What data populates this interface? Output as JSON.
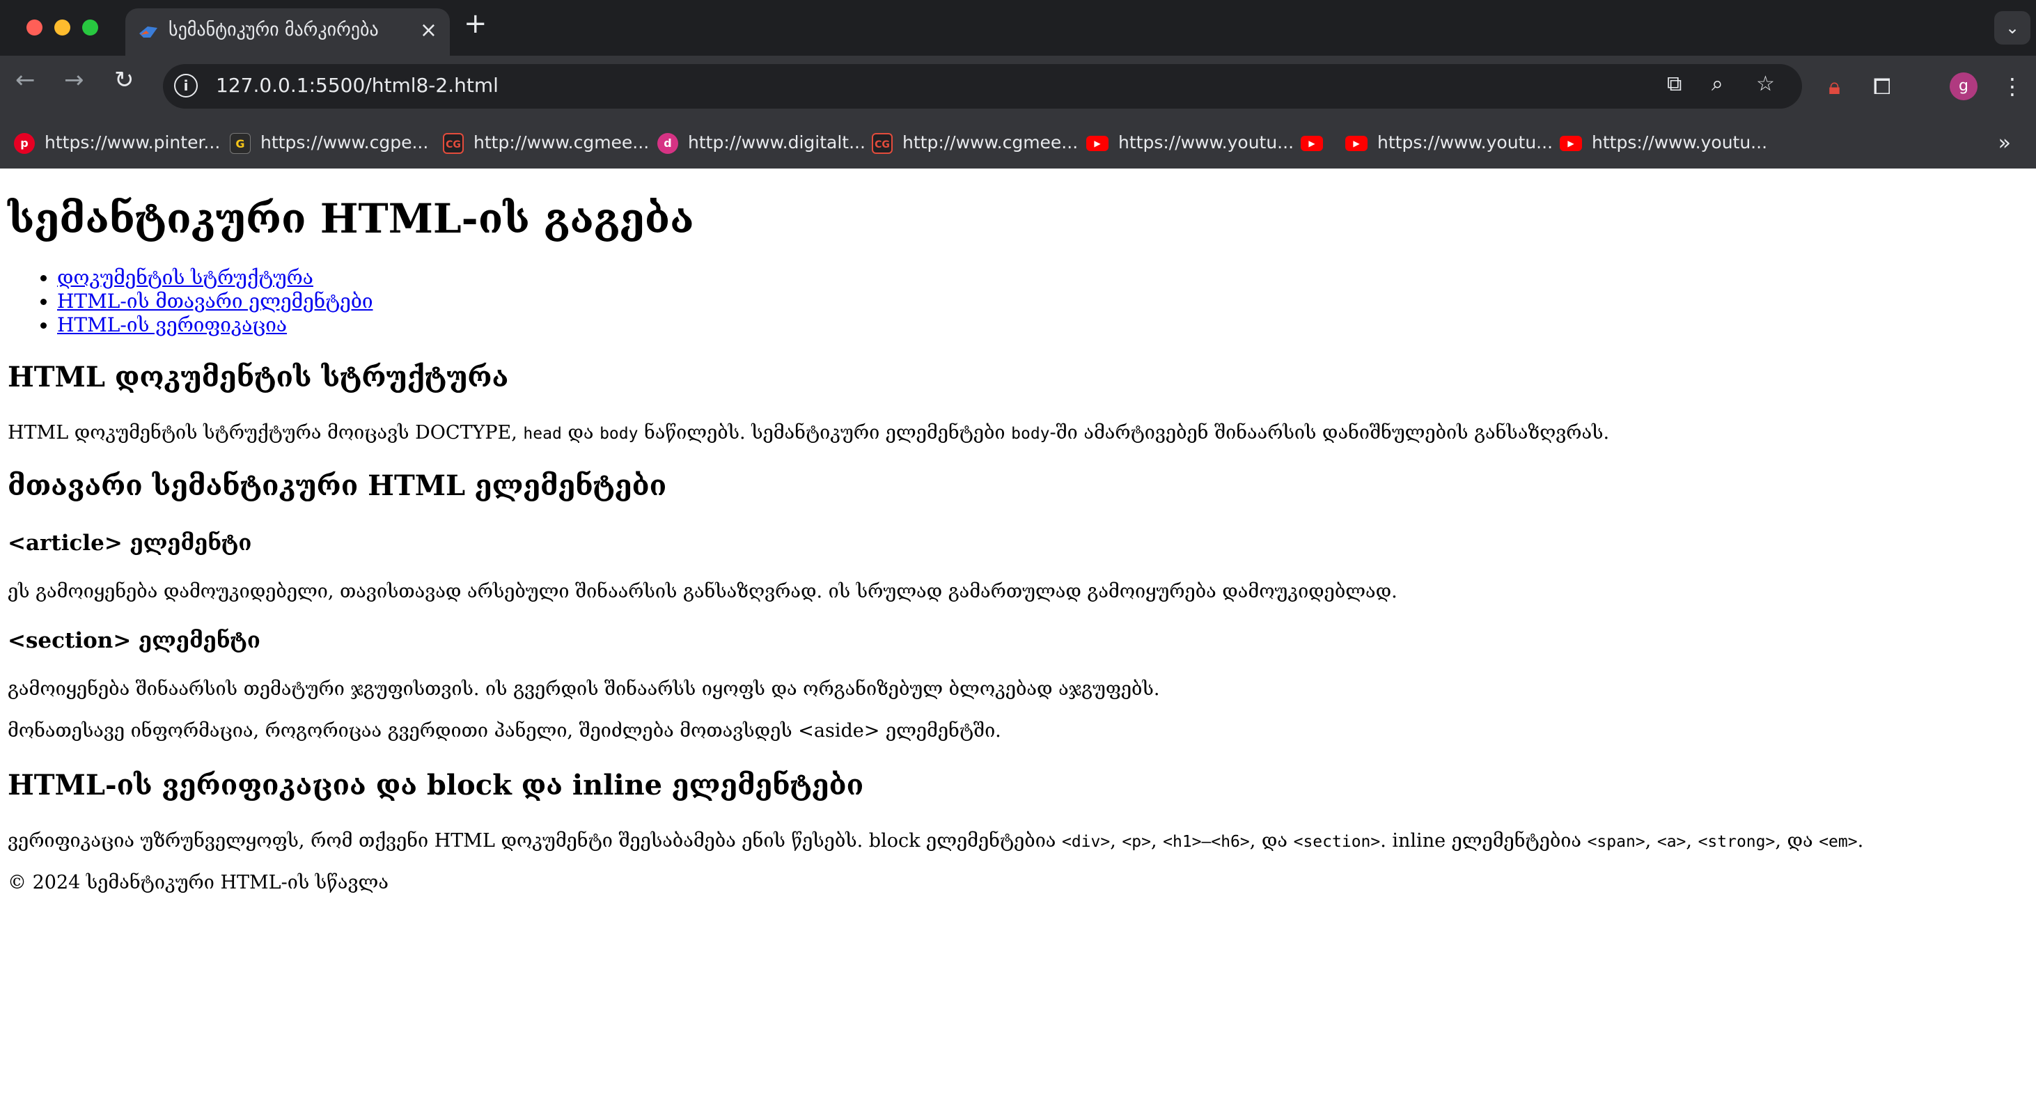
{
  "browser": {
    "tab_title": "სემანტიკური მარკირება",
    "tab_close": "×",
    "new_tab": "+",
    "url": "127.0.0.1:5500/html8-2.html",
    "profile_initial": "g",
    "bookmarks": [
      {
        "label": "https://www.pinter...",
        "icon": "pinterest-icon"
      },
      {
        "label": "https://www.cgpe...",
        "icon": "cgpeers-icon"
      },
      {
        "label": "http://www.cgmee...",
        "icon": "cgmeetup-icon"
      },
      {
        "label": "http://www.digitalt...",
        "icon": "digitaltutors-icon"
      },
      {
        "label": "http://www.cgmee...",
        "icon": "cgmeetup-icon"
      },
      {
        "label": "https://www.youtu...",
        "icon": "youtube-icon"
      },
      {
        "label": "",
        "icon": "youtube-icon"
      },
      {
        "label": "https://www.youtu...",
        "icon": "youtube-icon"
      },
      {
        "label": "https://www.youtu...",
        "icon": "youtube-icon"
      }
    ]
  },
  "page": {
    "title": "სემანტიკური HTML-ის გაგება",
    "toc": [
      "დოკუმენტის სტრუქტურა",
      "HTML-ის მთავარი ელემენტები",
      "HTML-ის ვერიფიკაცია"
    ],
    "s1_heading": "HTML დოკუმენტის სტრუქტურა",
    "s1_p": {
      "a": "HTML დოკუმენტის სტრუქტურა მოიცავს DOCTYPE, ",
      "code1": "head",
      "b": " და ",
      "code2": "body",
      "c": " ნაწილებს. სემანტიკური ელემენტები ",
      "code3": "body",
      "d": "-ში ამარტივებენ შინაარსის დანიშნულების განსაზღვრას."
    },
    "s2_heading": "მთავარი სემანტიკური HTML ელემენტები",
    "article_heading": "<article> ელემენტი",
    "article_p": "ეს გამოიყენება დამოუკიდებელი, თავისთავად არსებული შინაარსის განსაზღვრად. ის სრულად გამართულად გამოიყურება დამოუკიდებლად.",
    "section_heading": "<section> ელემენტი",
    "section_p1": "გამოიყენება შინაარსის თემატური ჯგუფისთვის. ის გვერდის შინაარსს იყოფს და ორგანიზებულ ბლოკებად აჯგუფებს.",
    "section_p2": "მონათესავე ინფორმაცია, როგორიცაა გვერდითი პანელი, შეიძლება მოთავსდეს <aside> ელემენტში.",
    "s3_heading": "HTML-ის ვერიფიკაცია და block და inline ელემენტები",
    "s3_p": {
      "a": "ვერიფიკაცია უზრუნველყოფს, რომ თქვენი HTML დოკუმენტი შეესაბამება ენის წესებს. block ელემენტებია ",
      "c1": "<div>",
      "s1": ", ",
      "c2": "<p>",
      "s2": ", ",
      "c3": "<h1>–<h6>",
      "s3": ", და ",
      "c4": "<section>",
      "s4": ". inline ელემენტებია ",
      "c5": "<span>",
      "s5": ", ",
      "c6": "<a>",
      "s6": ", ",
      "c7": "<strong>",
      "s7": ", და ",
      "c8": "<em>",
      "s8": "."
    },
    "footer": "© 2024 სემანტიკური HTML-ის სწავლა"
  }
}
